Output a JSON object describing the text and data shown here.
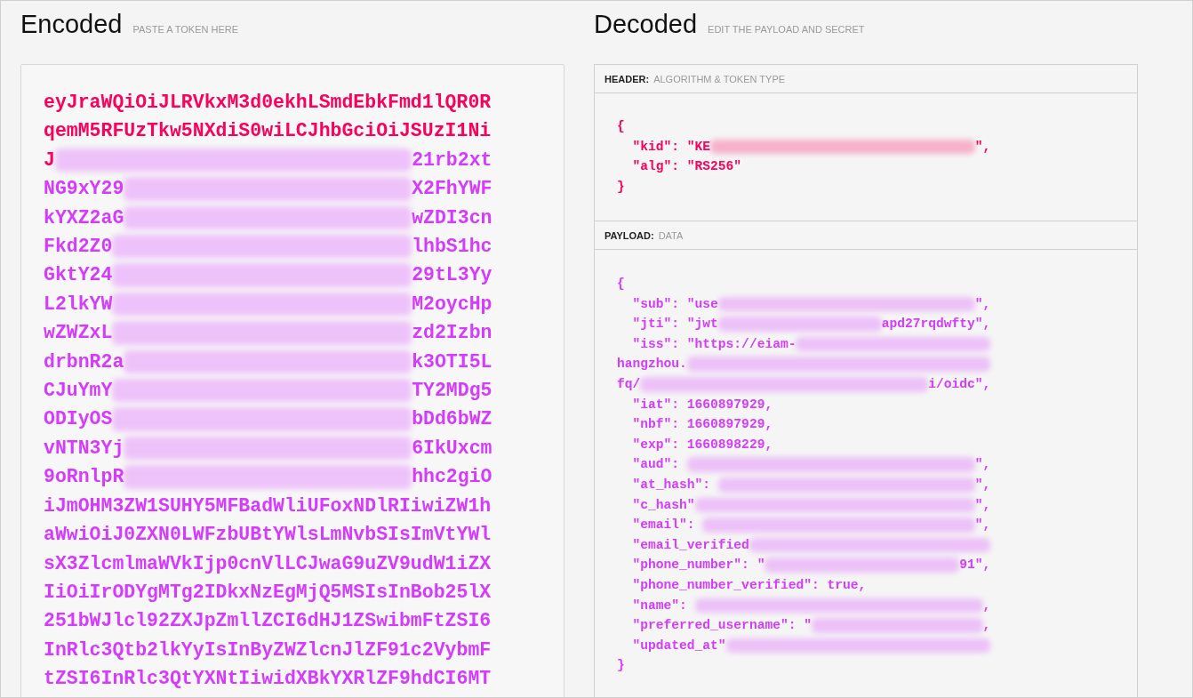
{
  "encoded": {
    "title": "Encoded",
    "subtitle": "PASTE A TOKEN HERE",
    "lines": [
      {
        "segments": [
          {
            "kind": "text",
            "color": "#fb015b",
            "text": "eyJraWQiOiJLRVkxM3d0ekhLSmdEbkFmd1lQR0R"
          }
        ]
      },
      {
        "segments": [
          {
            "kind": "text",
            "color": "#fb015b",
            "text": "qemM5RFUzTkw5NXdiS0wiLCJhbGciOiJSUzI1Ni"
          }
        ]
      },
      {
        "segments": [
          {
            "kind": "text",
            "color": "#fb015b",
            "text": "J"
          },
          {
            "kind": "redacted"
          },
          {
            "kind": "text",
            "color": "#d63aff",
            "text": "21rb2xt"
          }
        ]
      },
      {
        "segments": [
          {
            "kind": "text",
            "color": "#d63aff",
            "text": "NG9xY29"
          },
          {
            "kind": "redacted"
          },
          {
            "kind": "text",
            "color": "#d63aff",
            "text": "X2FhYWF"
          }
        ]
      },
      {
        "segments": [
          {
            "kind": "text",
            "color": "#d63aff",
            "text": "kYXZ2aG"
          },
          {
            "kind": "redacted"
          },
          {
            "kind": "text",
            "color": "#d63aff",
            "text": "wZDI3cn"
          }
        ]
      },
      {
        "segments": [
          {
            "kind": "text",
            "color": "#d63aff",
            "text": "Fkd2Z0"
          },
          {
            "kind": "redacted"
          },
          {
            "kind": "text",
            "color": "#d63aff",
            "text": "lhbS1hc"
          }
        ]
      },
      {
        "segments": [
          {
            "kind": "text",
            "color": "#d63aff",
            "text": "GktY24"
          },
          {
            "kind": "redacted"
          },
          {
            "kind": "text",
            "color": "#d63aff",
            "text": "29tL3Yy"
          }
        ]
      },
      {
        "segments": [
          {
            "kind": "text",
            "color": "#d63aff",
            "text": "L2lkYW"
          },
          {
            "kind": "redacted"
          },
          {
            "kind": "text",
            "color": "#d63aff",
            "text": "M2oycHp"
          }
        ]
      },
      {
        "segments": [
          {
            "kind": "text",
            "color": "#d63aff",
            "text": "wZWZxL"
          },
          {
            "kind": "redacted"
          },
          {
            "kind": "text",
            "color": "#d63aff",
            "text": "zd2Izbn"
          }
        ]
      },
      {
        "segments": [
          {
            "kind": "text",
            "color": "#d63aff",
            "text": "drbnR2a"
          },
          {
            "kind": "redacted"
          },
          {
            "kind": "text",
            "color": "#d63aff",
            "text": "k3OTI5L"
          }
        ]
      },
      {
        "segments": [
          {
            "kind": "text",
            "color": "#d63aff",
            "text": "CJuYmY"
          },
          {
            "kind": "redacted"
          },
          {
            "kind": "text",
            "color": "#d63aff",
            "text": "TY2MDg5"
          }
        ]
      },
      {
        "segments": [
          {
            "kind": "text",
            "color": "#d63aff",
            "text": "ODIyOS"
          },
          {
            "kind": "redacted"
          },
          {
            "kind": "text",
            "color": "#d63aff",
            "text": "bDd6bWZ"
          }
        ]
      },
      {
        "segments": [
          {
            "kind": "text",
            "color": "#d63aff",
            "text": "vNTN3Yj"
          },
          {
            "kind": "redacted"
          },
          {
            "kind": "text",
            "color": "#d63aff",
            "text": "6IkUxcm"
          }
        ]
      },
      {
        "segments": [
          {
            "kind": "text",
            "color": "#d63aff",
            "text": "9oRnlpR"
          },
          {
            "kind": "redacted"
          },
          {
            "kind": "text",
            "color": "#d63aff",
            "text": "hhc2giO"
          }
        ]
      },
      {
        "segments": [
          {
            "kind": "text",
            "color": "#d63aff",
            "text": "iJmOHM3ZW1SUHY5MFBadWliUFoxNDlRIiwiZW1h"
          }
        ]
      },
      {
        "segments": [
          {
            "kind": "text",
            "color": "#d63aff",
            "text": "aWwiOiJ0ZXN0LWFzbUBtYWlsLmNvbSIsImVtYWl"
          }
        ]
      },
      {
        "segments": [
          {
            "kind": "text",
            "color": "#d63aff",
            "text": "sX3ZlcmlmaWVkIjp0cnVlLCJwaG9uZV9udW1iZX"
          }
        ]
      },
      {
        "segments": [
          {
            "kind": "text",
            "color": "#d63aff",
            "text": "IiOiIrODYgMTg2IDkxNzEgMjQ5MSIsInBob25lX"
          }
        ]
      },
      {
        "segments": [
          {
            "kind": "text",
            "color": "#d63aff",
            "text": "251bWJlcl92ZXJpZmllZCI6dHJ1ZSwibmFtZSI6"
          }
        ]
      },
      {
        "segments": [
          {
            "kind": "text",
            "color": "#d63aff",
            "text": "InRlc3Qtb2lkYyIsInByZWZlcnJlZF91c2VybmF"
          }
        ]
      },
      {
        "segments": [
          {
            "kind": "text",
            "color": "#d63aff",
            "text": "tZSI6InRlc3QtYXNtIiwidXBkYXRlZF9hdCI6MT"
          }
        ]
      }
    ]
  },
  "decoded": {
    "title": "Decoded",
    "subtitle": "EDIT THE PAYLOAD AND SECRET",
    "sections": [
      {
        "label": "HEADER:",
        "sublabel": "ALGORITHM & TOKEN TYPE",
        "color": "#fb015b",
        "lines": [
          {
            "segments": [
              {
                "kind": "text",
                "text": "{"
              }
            ]
          },
          {
            "segments": [
              {
                "kind": "text",
                "text": "  \"kid\": \"KE"
              },
              {
                "kind": "redacted"
              },
              {
                "kind": "text",
                "text": "\","
              }
            ]
          },
          {
            "segments": [
              {
                "kind": "text",
                "text": "  \"alg\": \"RS256\""
              }
            ]
          },
          {
            "segments": [
              {
                "kind": "text",
                "text": "}"
              }
            ]
          }
        ]
      },
      {
        "label": "PAYLOAD:",
        "sublabel": "DATA",
        "color": "#d63aff",
        "lines": [
          {
            "segments": [
              {
                "kind": "text",
                "text": "{"
              }
            ]
          },
          {
            "segments": [
              {
                "kind": "text",
                "text": "  \"sub\": \"use"
              },
              {
                "kind": "redacted"
              },
              {
                "kind": "text",
                "text": "\","
              }
            ]
          },
          {
            "segments": [
              {
                "kind": "text",
                "text": "  \"jti\": \"jwt"
              },
              {
                "kind": "redacted"
              },
              {
                "kind": "text",
                "text": "apd27rqdwfty\","
              }
            ]
          },
          {
            "segments": [
              {
                "kind": "text",
                "text": "  \"iss\": \"https://eiam-"
              },
              {
                "kind": "redacted"
              }
            ]
          },
          {
            "segments": [
              {
                "kind": "text",
                "text": "hangzhou."
              },
              {
                "kind": "redacted"
              }
            ]
          },
          {
            "segments": [
              {
                "kind": "text",
                "text": "fq/"
              },
              {
                "kind": "redacted"
              },
              {
                "kind": "text",
                "text": "i/oidc\","
              }
            ]
          },
          {
            "segments": [
              {
                "kind": "text",
                "text": "  \"iat\": 1660897929,"
              }
            ]
          },
          {
            "segments": [
              {
                "kind": "text",
                "text": "  \"nbf\": 1660897929,"
              }
            ]
          },
          {
            "segments": [
              {
                "kind": "text",
                "text": "  \"exp\": 1660898229,"
              }
            ]
          },
          {
            "segments": [
              {
                "kind": "text",
                "text": "  \"aud\": "
              },
              {
                "kind": "redacted"
              },
              {
                "kind": "text",
                "text": "\","
              }
            ]
          },
          {
            "segments": [
              {
                "kind": "text",
                "text": "  \"at_hash\": "
              },
              {
                "kind": "redacted"
              },
              {
                "kind": "text",
                "text": "\","
              }
            ]
          },
          {
            "segments": [
              {
                "kind": "text",
                "text": "  \"c_hash\""
              },
              {
                "kind": "redacted"
              },
              {
                "kind": "text",
                "text": "\","
              }
            ]
          },
          {
            "segments": [
              {
                "kind": "text",
                "text": "  \"email\": "
              },
              {
                "kind": "redacted"
              },
              {
                "kind": "text",
                "text": "\","
              }
            ]
          },
          {
            "segments": [
              {
                "kind": "text",
                "text": "  \"email_verified"
              },
              {
                "kind": "redacted"
              }
            ]
          },
          {
            "segments": [
              {
                "kind": "text",
                "text": "  \"phone_number\": \""
              },
              {
                "kind": "redacted"
              },
              {
                "kind": "text",
                "text": "91\","
              }
            ]
          },
          {
            "segments": [
              {
                "kind": "text",
                "text": "  \"phone_number_verified\": true,"
              }
            ]
          },
          {
            "segments": [
              {
                "kind": "text",
                "text": "  \"name\": "
              },
              {
                "kind": "redacted"
              },
              {
                "kind": "text",
                "text": ","
              }
            ]
          },
          {
            "segments": [
              {
                "kind": "text",
                "text": "  \"preferred_username\": \""
              },
              {
                "kind": "redacted"
              },
              {
                "kind": "text",
                "text": ","
              }
            ]
          },
          {
            "segments": [
              {
                "kind": "text",
                "text": "  \"updated_at\""
              },
              {
                "kind": "redacted"
              }
            ]
          },
          {
            "segments": [
              {
                "kind": "text",
                "text": "}"
              }
            ]
          }
        ]
      }
    ]
  }
}
